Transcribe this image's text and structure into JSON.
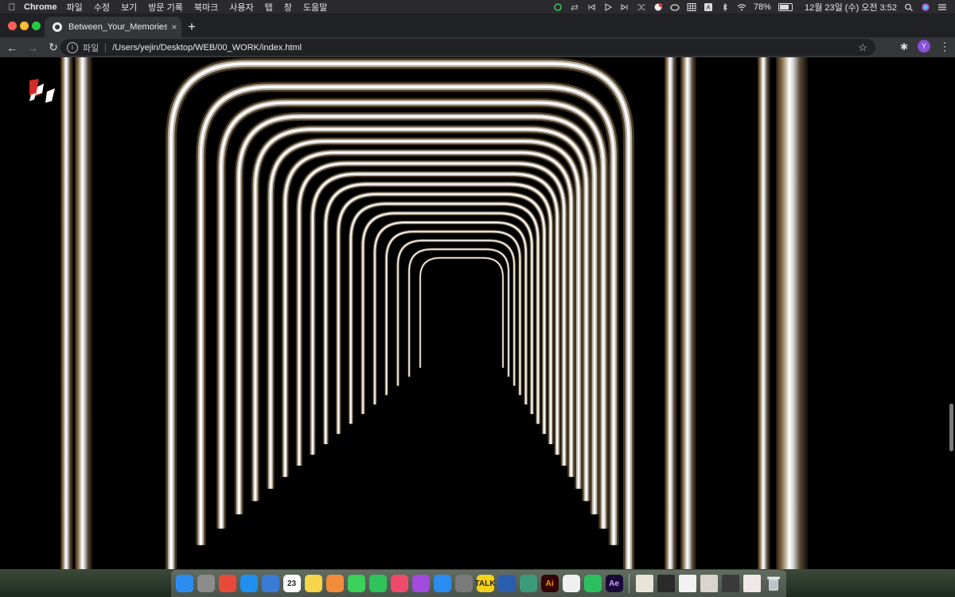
{
  "menubar": {
    "app_name": "Chrome",
    "menus": [
      "파일",
      "수정",
      "보기",
      "방문 기록",
      "북마크",
      "사용자",
      "탭",
      "창",
      "도움말"
    ],
    "battery": "78%",
    "datetime": "12월 23일 (수) 오전  3:52"
  },
  "tab": {
    "title": "Between_Your_Memories",
    "close_glyph": "×",
    "new_tab_glyph": "+"
  },
  "toolbar": {
    "back_glyph": "←",
    "forward_glyph": "→",
    "reload_glyph": "↻",
    "scheme_label": "파일",
    "url": "/Users/yejin/Desktop/WEB/00_WORK/index.html",
    "bookmark_glyph": "☆",
    "extensions_glyph": "✱",
    "profile_initial": "Y",
    "menu_glyph": "⋮"
  },
  "colors": {
    "menubar_bg": "#2b2b2d",
    "tabstrip_bg": "#202124",
    "tab_active_bg": "#35363a",
    "page_bg": "#000000",
    "profile_accent": "#8a4fd6",
    "traffic_close": "#ff5f57",
    "traffic_min": "#febc2e",
    "traffic_max": "#28c840",
    "logo_red": "#d42a2a"
  },
  "page": {
    "logo_icon": "red-white-torn-logo",
    "scene": "arch-tunnel-artwork"
  },
  "dock": {
    "apps": [
      {
        "name": "Finder",
        "icon": "finder-icon",
        "color": "#2a8cf0",
        "label": ""
      },
      {
        "name": "Launchpad",
        "icon": "rocket-icon",
        "color": "#8c8c8c",
        "label": ""
      },
      {
        "name": "Chrome",
        "icon": "chrome-icon",
        "color": "#e84a3a",
        "label": ""
      },
      {
        "name": "Safari",
        "icon": "compass-icon",
        "color": "#1f8ff0",
        "label": ""
      },
      {
        "name": "Preview",
        "icon": "preview-icon",
        "color": "#3a7bd5",
        "label": ""
      },
      {
        "name": "Calendar",
        "icon": "calendar-icon",
        "color": "#ffffff",
        "label": "23"
      },
      {
        "name": "Notes",
        "icon": "notes-icon",
        "color": "#f6d54a",
        "label": ""
      },
      {
        "name": "Photos",
        "icon": "photos-icon",
        "color": "#f08c3a",
        "label": ""
      },
      {
        "name": "Messages",
        "icon": "speech-bubble-icon",
        "color": "#3ad05a",
        "label": ""
      },
      {
        "name": "FaceTime",
        "icon": "video-camera-icon",
        "color": "#2ec45a",
        "label": ""
      },
      {
        "name": "Music",
        "icon": "music-note-icon",
        "color": "#f04a6a",
        "label": ""
      },
      {
        "name": "Podcasts",
        "icon": "podcast-icon",
        "color": "#a24adf",
        "label": ""
      },
      {
        "name": "App Store",
        "icon": "app-store-icon",
        "color": "#2a8cf0",
        "label": ""
      },
      {
        "name": "System Preferences",
        "icon": "gear-icon",
        "color": "#7a7a7a",
        "label": ""
      },
      {
        "name": "KakaoTalk",
        "icon": "talk-icon",
        "color": "#f5d21a",
        "label": "TALK"
      },
      {
        "name": "Cinema 4D",
        "icon": "sphere-icon",
        "color": "#2a5fb0",
        "label": ""
      },
      {
        "name": "Atom",
        "icon": "atom-icon",
        "color": "#3a9a7a",
        "label": ""
      },
      {
        "name": "Illustrator",
        "icon": "illustrator-icon",
        "color": "#330000",
        "label": "Ai"
      },
      {
        "name": "Acrobat",
        "icon": "acrobat-icon",
        "color": "#f0f0f0",
        "label": ""
      },
      {
        "name": "Evernote",
        "icon": "evernote-icon",
        "color": "#2dbe60",
        "label": ""
      },
      {
        "name": "After Effects",
        "icon": "after-effects-icon",
        "color": "#1a0a3a",
        "label": "Ae"
      }
    ],
    "recents": [
      "recent-window-thumbnail-1",
      "recent-window-thumbnail-2",
      "recent-window-thumbnail-3",
      "recent-window-thumbnail-4",
      "recent-window-thumbnail-5",
      "recent-window-thumbnail-6"
    ],
    "trash_icon": "trash-icon"
  }
}
